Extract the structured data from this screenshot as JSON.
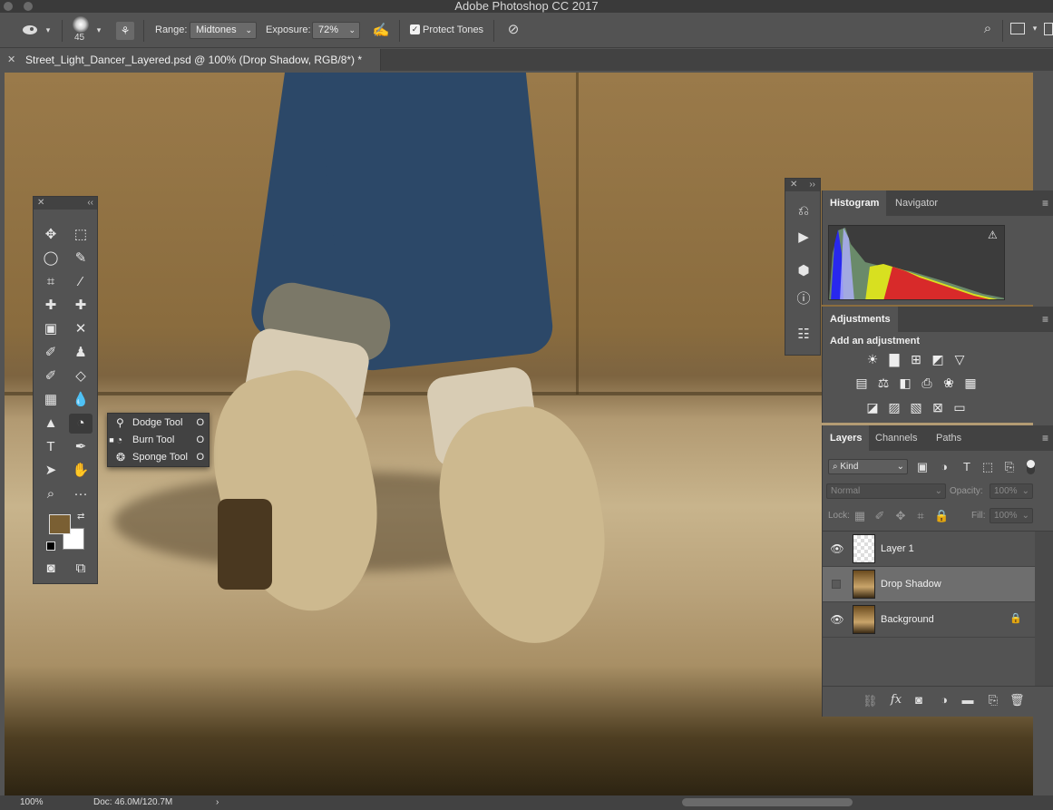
{
  "window": {
    "title": "Adobe Photoshop CC 2017"
  },
  "options_bar": {
    "brush_size": "45",
    "range_label": "Range:",
    "range_value": "Midtones",
    "exposure_label": "Exposure:",
    "exposure_value": "72%",
    "protect_tones_label": "Protect Tones",
    "protect_tones_checked": true
  },
  "document_tab": {
    "title": "Street_Light_Dancer_Layered.psd @ 100% (Drop Shadow, RGB/8*) *"
  },
  "tool_flyout": {
    "items": [
      {
        "label": "Dodge Tool",
        "shortcut": "O",
        "selected": false
      },
      {
        "label": "Burn Tool",
        "shortcut": "O",
        "selected": true
      },
      {
        "label": "Sponge Tool",
        "shortcut": "O",
        "selected": false
      }
    ]
  },
  "colors": {
    "foreground": "#7a5f33",
    "background": "#ffffff",
    "accent": "#4a90d9"
  },
  "histogram_panel": {
    "tabs": [
      "Histogram",
      "Navigator"
    ],
    "active_tab": "Histogram"
  },
  "adjustments_panel": {
    "tab": "Adjustments",
    "title": "Add an adjustment"
  },
  "layers_panel": {
    "tabs": [
      "Layers",
      "Channels",
      "Paths"
    ],
    "active_tab": "Layers",
    "filter_kind": "Kind",
    "blend_mode": "Normal",
    "opacity_label": "Opacity:",
    "opacity_value": "100%",
    "lock_label": "Lock:",
    "fill_label": "Fill:",
    "fill_value": "100%",
    "layers": [
      {
        "name": "Layer 1",
        "visible": true,
        "selected": false,
        "locked": false
      },
      {
        "name": "Drop Shadow",
        "visible": false,
        "selected": true,
        "locked": false
      },
      {
        "name": "Background",
        "visible": true,
        "selected": false,
        "locked": true
      }
    ]
  },
  "status_bar": {
    "zoom": "100%",
    "doc_size": "Doc: 46.0M/120.7M"
  }
}
